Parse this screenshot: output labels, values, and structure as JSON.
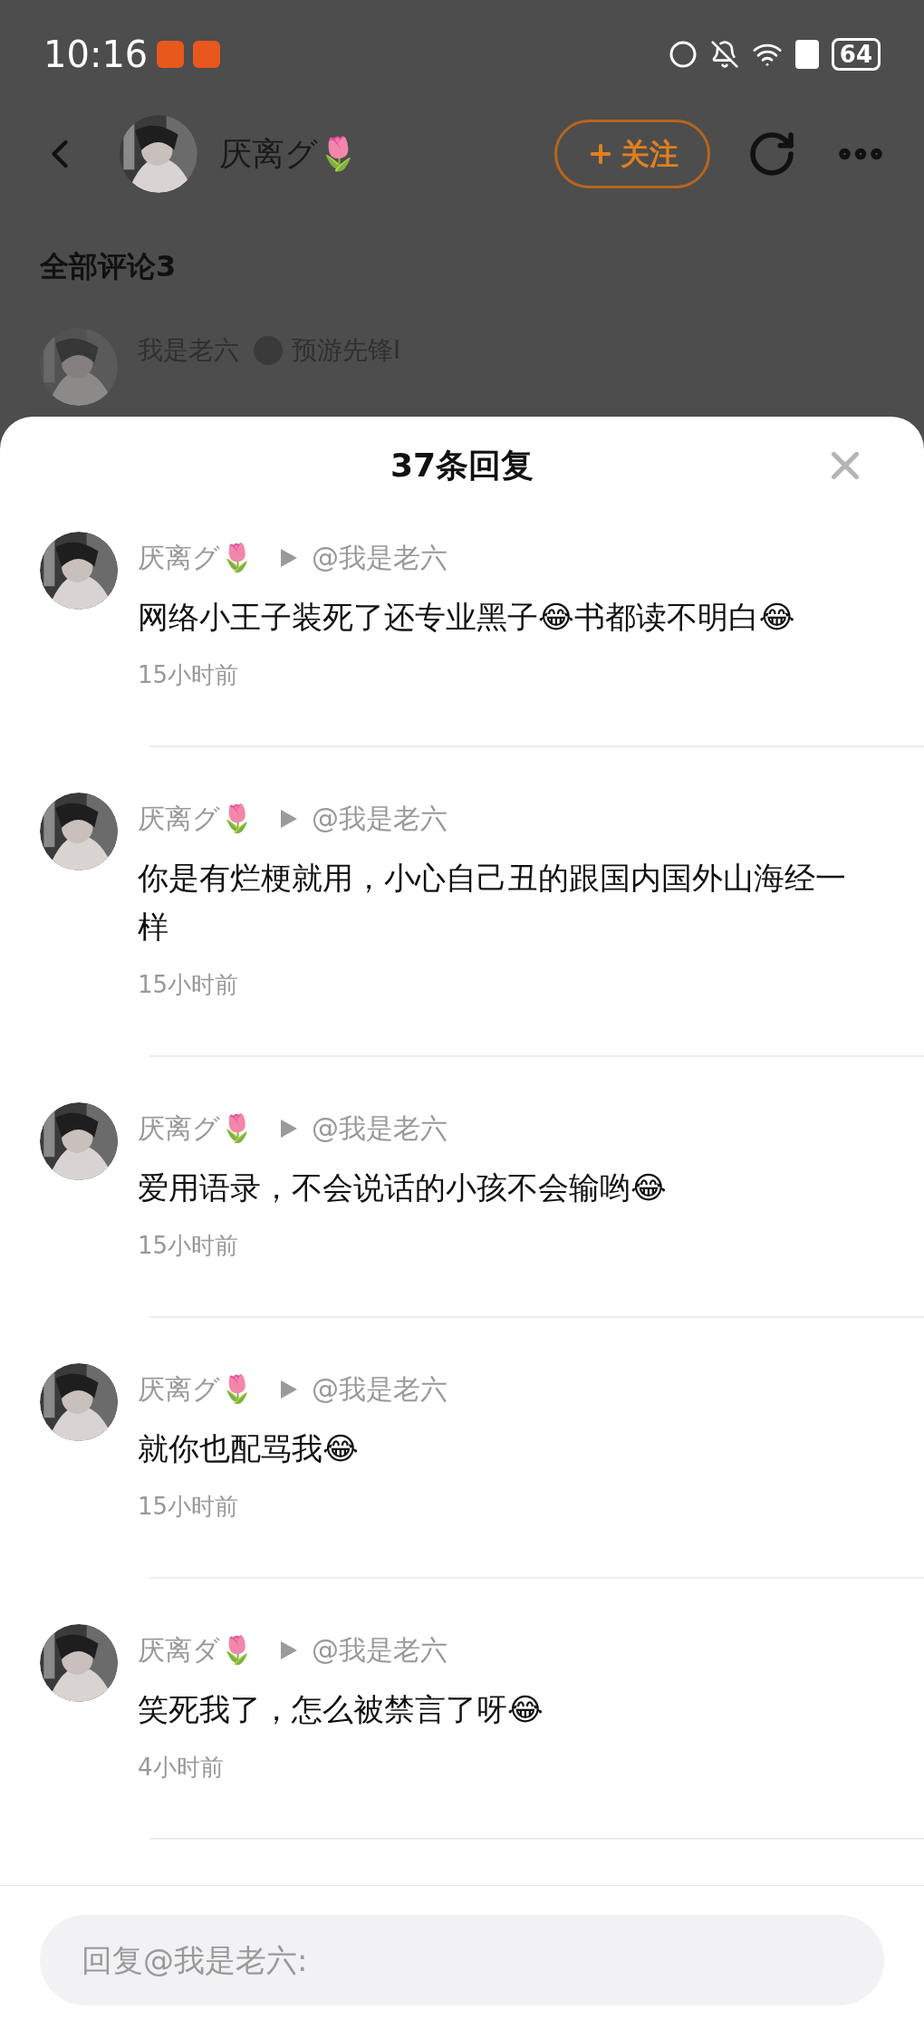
{
  "status_bar": {
    "time": "10:16",
    "battery": "64"
  },
  "header": {
    "name": "厌离グ🌷",
    "follow_button": "关注"
  },
  "section_title": "全部评论3",
  "peek_comment": {
    "author": "我是老六",
    "badge": "预游先锋I"
  },
  "sheet": {
    "title": "37条回复",
    "replies": [
      {
        "author": "厌离グ🌷",
        "reply_to": "@我是老六",
        "text": "网络小王子装死了还专业黑子😂书都读不明白😂",
        "time": "15小时前"
      },
      {
        "author": "厌离グ🌷",
        "reply_to": "@我是老六",
        "text": "你是有烂梗就用，小心自己丑的跟国内国外山海经一样",
        "time": "15小时前"
      },
      {
        "author": "厌离グ🌷",
        "reply_to": "@我是老六",
        "text": "爱用语录，不会说话的小孩不会输哟😂",
        "time": "15小时前"
      },
      {
        "author": "厌离グ🌷",
        "reply_to": "@我是老六",
        "text": "就你也配骂我😂",
        "time": "15小时前"
      },
      {
        "author": "厌离ダ🌷",
        "reply_to": "@我是老六",
        "text": "笑死我了，怎么被禁言了呀😂",
        "time": "4小时前"
      }
    ],
    "reply_field": {
      "placeholder": "回复@我是老六:"
    }
  }
}
